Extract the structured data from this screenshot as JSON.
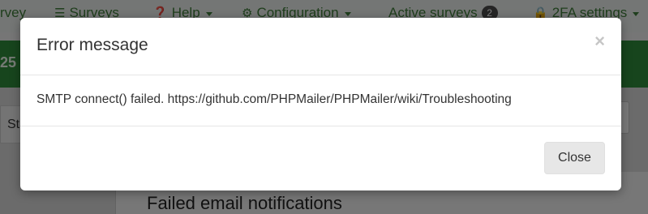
{
  "nav": {
    "items": [
      {
        "label": "rvey"
      },
      {
        "label": "Surveys",
        "icon": "list-icon"
      },
      {
        "label": "Help",
        "icon": "question-circle-icon",
        "dropdown": true
      },
      {
        "label": "Configuration",
        "icon": "cogs-icon",
        "dropdown": true
      },
      {
        "label": "Active surveys",
        "badge": "2"
      },
      {
        "label": "2FA settings",
        "icon": "lock-icon",
        "dropdown": true
      }
    ]
  },
  "background": {
    "green_bar_text": "25",
    "left_box_text": "St",
    "content_title": "Failed email notifications"
  },
  "modal": {
    "title": "Error message",
    "close_symbol": "×",
    "message": "SMTP connect() failed. https://github.com/PHPMailer/PHPMailer/wiki/Troubleshooting",
    "close_button_label": "Close"
  },
  "colors": {
    "nav_text": "#3f7d3a",
    "green_bar": "#2f8a3a",
    "backdrop": "rgba(0,0,0,0.5)"
  }
}
